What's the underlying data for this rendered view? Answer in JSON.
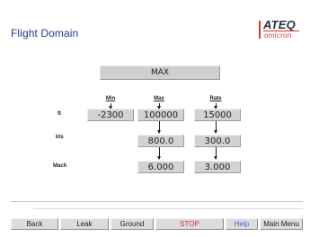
{
  "header": {
    "title": "Flight Domain",
    "logo": {
      "brand": "ATEQ",
      "sub": "omicron"
    }
  },
  "mode": "MAX",
  "columns": {
    "min": "Min",
    "max": "Max",
    "rate": "Rate"
  },
  "rows": [
    {
      "unit": "ft",
      "min": "-2300",
      "max": "100000",
      "rate": "15000"
    },
    {
      "unit": "kts",
      "max": "800.0",
      "rate": "300.0"
    },
    {
      "unit": "Mach",
      "max": "6.000",
      "rate": "3.000"
    }
  ],
  "toolbar": {
    "back": "Back",
    "leak": "Leak",
    "ground": "Ground",
    "stop": "STOP",
    "help": "Help",
    "main_menu": "Main Menu"
  },
  "colors": {
    "title": "#1f3b8a",
    "stop": "#d8353a",
    "help": "#3a6fd0",
    "brand_accent": "#d23a2f"
  }
}
